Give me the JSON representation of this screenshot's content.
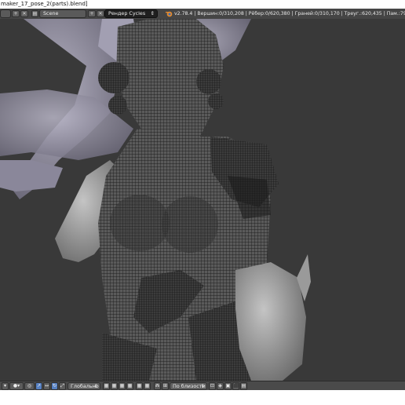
{
  "window": {
    "title": "maker_17_pose_2(parts).blend]"
  },
  "header": {
    "scene_label": "Scene",
    "render_engine": "Рендер Cycles",
    "version": "v2.78.4",
    "stats": "v2.78.4 | Вершин:0/310,208 | Рёбер:0/620,380 | Граней:0/310,170 | Треуг.:620,435 | Пам.:790.17M6 | 25_widowmak"
  },
  "footer": {
    "pivot_label": "Глобально",
    "snap_label": "По близости"
  },
  "colors": {
    "viewport_bg": "#393939",
    "header_bg": "#454545",
    "selected_blue": "#5680c2"
  },
  "icons": [
    "render-engine-icon",
    "blender-logo-icon",
    "global-orientation-icon",
    "magnet-icon",
    "layer-icon",
    "camera-icon"
  ]
}
